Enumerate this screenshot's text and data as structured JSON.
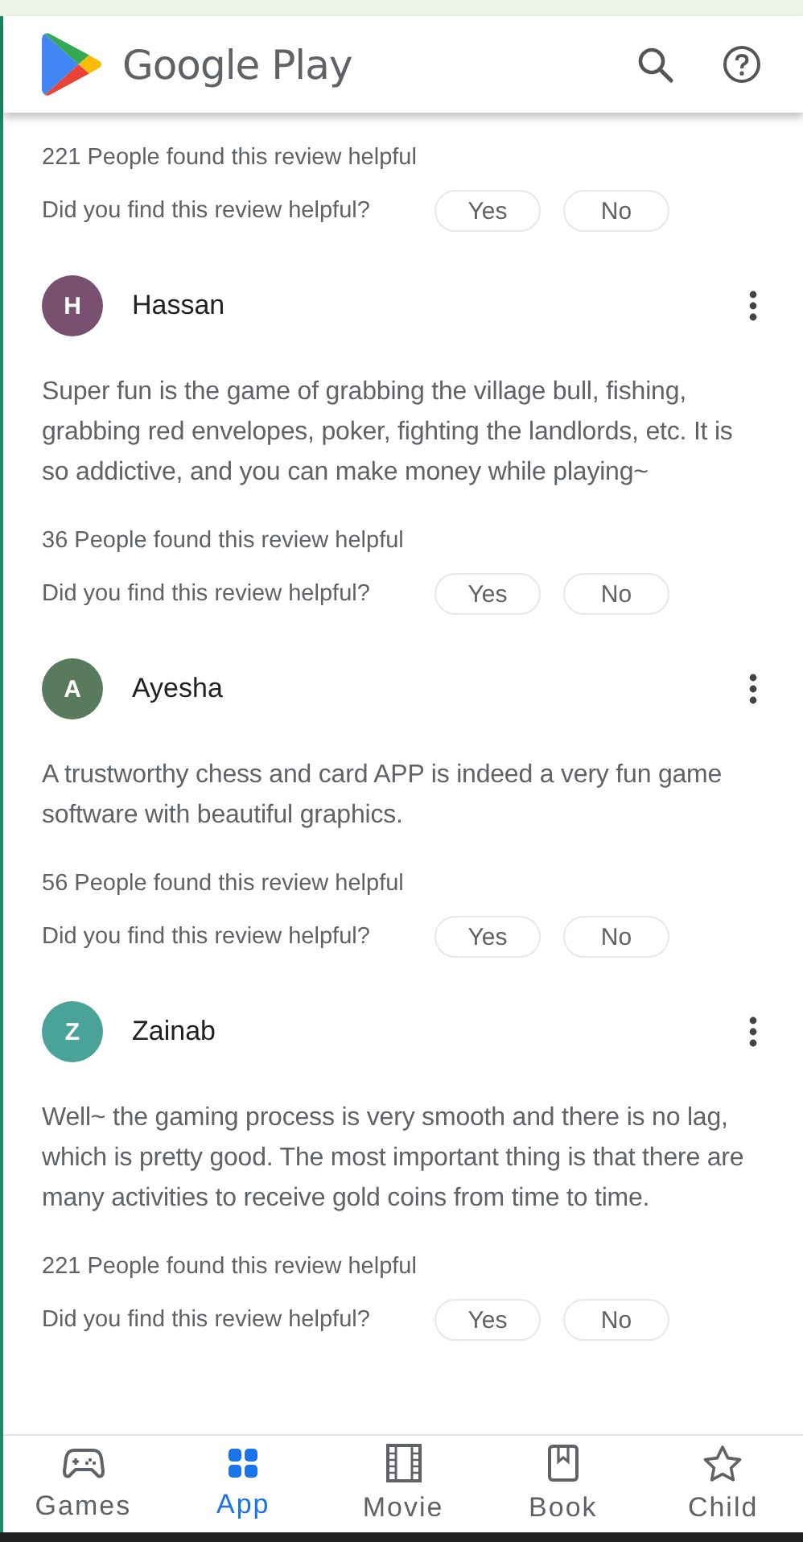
{
  "header": {
    "title": "Google Play"
  },
  "reviews": [
    {
      "helpful_count": "221 People found this review helpful",
      "question": "Did you find this review helpful?",
      "yes": "Yes",
      "no": "No"
    },
    {
      "author": "Hassan",
      "initial": "H",
      "color": "#7a5070",
      "body": "Super fun is the game of grabbing the village bull, fishing, grabbing red envelopes, poker, fighting the landlords, etc. It is so addictive, and you can make money while playing~",
      "helpful_count": "36 People found this review helpful",
      "question": "Did you find this review helpful?",
      "yes": "Yes",
      "no": "No"
    },
    {
      "author": "Ayesha",
      "initial": "A",
      "color": "#5a7a5e",
      "body": "A trustworthy chess and card APP is indeed a very fun game software with beautiful graphics.",
      "helpful_count": "56 People found this review helpful",
      "question": "Did you find this review helpful?",
      "yes": "Yes",
      "no": "No"
    },
    {
      "author": "Zainab",
      "initial": "Z",
      "color": "#4aa398",
      "body": "Well~ the gaming process is very smooth and there is no lag, which is pretty good. The most important thing is that there are many activities to receive gold coins from time to time.",
      "helpful_count": "221 People found this review helpful",
      "question": "Did you find this review helpful?",
      "yes": "Yes",
      "no": "No"
    }
  ],
  "nav": [
    {
      "kind": "games",
      "label": "Games",
      "selected": false
    },
    {
      "kind": "apps",
      "label": "App",
      "selected": true
    },
    {
      "kind": "movies",
      "label": "Movie",
      "selected": false
    },
    {
      "kind": "books",
      "label": "Book",
      "selected": false
    },
    {
      "kind": "kids",
      "label": "Child",
      "selected": false
    }
  ]
}
